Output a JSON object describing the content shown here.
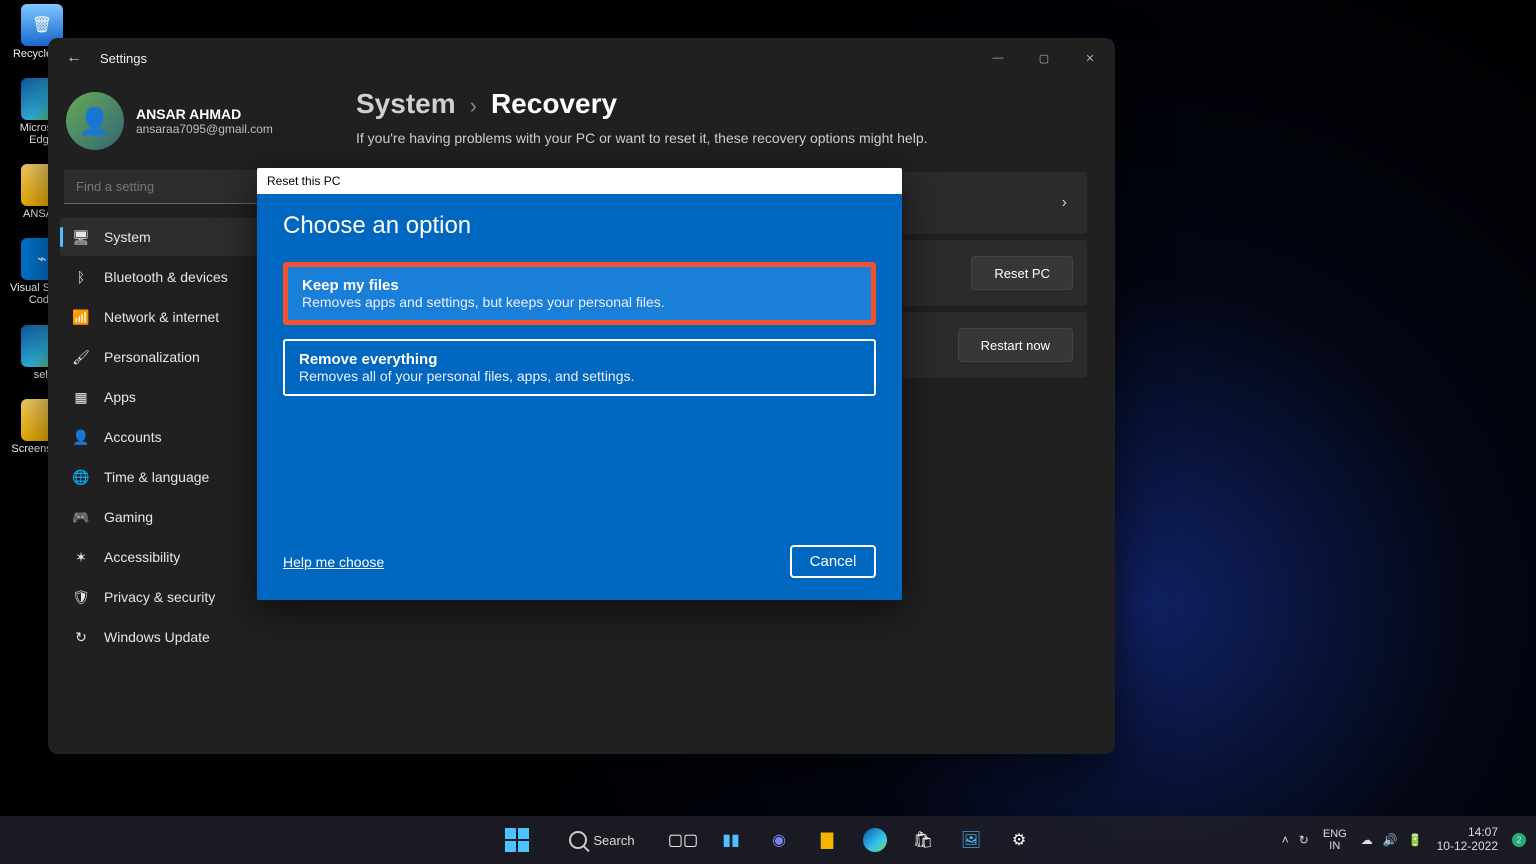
{
  "desktop": {
    "icons": [
      {
        "name": "Recycle Bin",
        "icon": "bin"
      },
      {
        "name": "Microsoft Edge",
        "icon": "edge"
      },
      {
        "name": "ANSAR",
        "icon": "folder"
      },
      {
        "name": "Visual Studio Code",
        "icon": "vscode"
      },
      {
        "name": "sell",
        "icon": "edge"
      },
      {
        "name": "Screenshots",
        "icon": "folder"
      }
    ]
  },
  "window": {
    "app_name": "Settings",
    "back_glyph": "←",
    "minimize_glyph": "—",
    "maximize_glyph": "▢",
    "close_glyph": "✕"
  },
  "profile": {
    "name": "ANSAR AHMAD",
    "email": "ansaraa7095@gmail.com"
  },
  "search": {
    "placeholder": "Find a setting"
  },
  "sidebar": {
    "items": [
      {
        "icon": "🖥",
        "label": "System",
        "active": true
      },
      {
        "icon": "ᛒ",
        "label": "Bluetooth & devices"
      },
      {
        "icon": "📶",
        "label": "Network & internet"
      },
      {
        "icon": "🖌",
        "label": "Personalization"
      },
      {
        "icon": "▦",
        "label": "Apps"
      },
      {
        "icon": "👤",
        "label": "Accounts"
      },
      {
        "icon": "🌐",
        "label": "Time & language"
      },
      {
        "icon": "🎮",
        "label": "Gaming"
      },
      {
        "icon": "✶",
        "label": "Accessibility"
      },
      {
        "icon": "🛡",
        "label": "Privacy & security"
      },
      {
        "icon": "↻",
        "label": "Windows Update"
      }
    ]
  },
  "main": {
    "bc_system": "System",
    "bc_sep": "›",
    "bc_page": "Recovery",
    "subtext": "If you're having problems with your PC or want to reset it, these recovery options might help.",
    "chevron": "›",
    "reset_pc_btn": "Reset PC",
    "restart_now_btn": "Restart now"
  },
  "dialog": {
    "title": "Reset this PC",
    "heading": "Choose an option",
    "keep_title": "Keep my files",
    "keep_desc": "Removes apps and settings, but keeps your personal files.",
    "remove_title": "Remove everything",
    "remove_desc": "Removes all of your personal files, apps, and settings.",
    "help": "Help me choose",
    "cancel": "Cancel"
  },
  "taskbar": {
    "search_label": "Search",
    "lang_top": "ENG",
    "lang_bottom": "IN",
    "time": "14:07",
    "date": "10-12-2022",
    "badge": "2",
    "tray_up": "˄",
    "tray_sync": "↻",
    "tray_drive": "☁",
    "tray_vol": "🔊",
    "tray_bat": "🔋"
  }
}
